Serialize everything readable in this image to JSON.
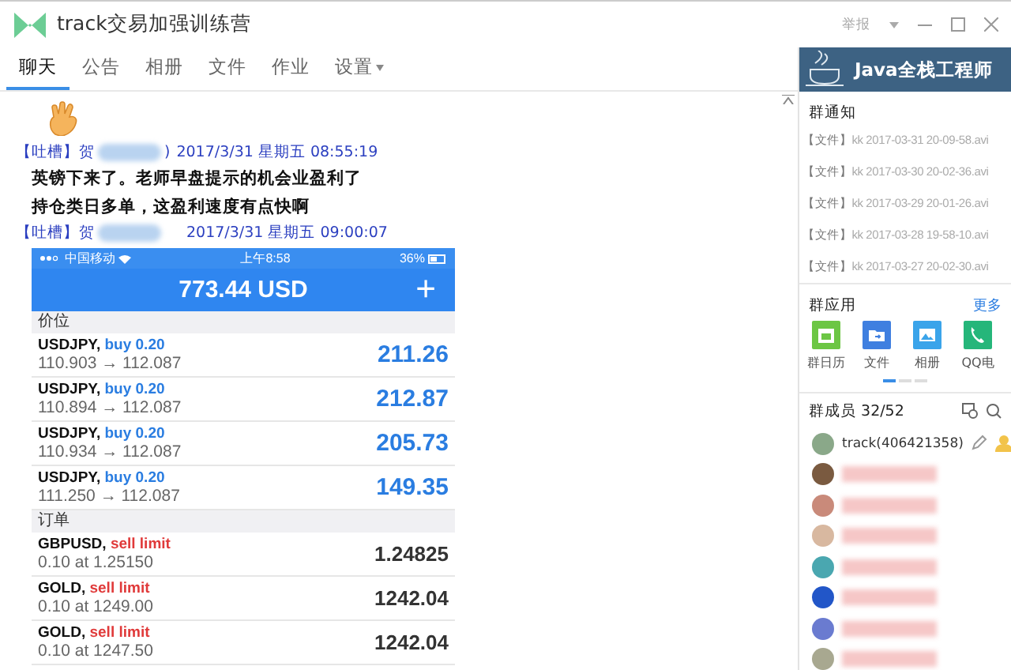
{
  "window": {
    "title": "track交易加强训练营",
    "report": "举报"
  },
  "tabs": [
    {
      "label": "聊天",
      "selected": true,
      "menu": false
    },
    {
      "label": "公告",
      "selected": false,
      "menu": false
    },
    {
      "label": "相册",
      "selected": false,
      "menu": false
    },
    {
      "label": "文件",
      "selected": false,
      "menu": false
    },
    {
      "label": "作业",
      "selected": false,
      "menu": false
    },
    {
      "label": "设置",
      "selected": false,
      "menu": true
    }
  ],
  "chat": {
    "messages": [
      {
        "kind": "emoji"
      },
      {
        "kind": "header",
        "tag": "【吐槽】",
        "sender": "贺",
        "sender_end": ")",
        "time": "2017/3/31 星期五 08:55:19"
      },
      {
        "kind": "text",
        "text": "英镑下来了。老师早盘提示的机会业盈利了"
      },
      {
        "kind": "text",
        "text": "持仓类日多单，这盈利速度有点快啊"
      },
      {
        "kind": "header",
        "tag": "【吐槽】",
        "sender": "贺",
        "time": "2017/3/31 星期五 09:00:07"
      },
      {
        "kind": "screenshot"
      }
    ]
  },
  "phone": {
    "carrier": "中国移动",
    "clock": "上午8:58",
    "battery": "36%",
    "balance": "773.44 USD",
    "add": "+",
    "sections": [
      {
        "title": "价位",
        "rows": [
          {
            "symbol": "USDJPY,",
            "action": "buy 0.20",
            "kind": "buy",
            "detail": "110.903 → 112.087",
            "value": "211.26"
          },
          {
            "symbol": "USDJPY,",
            "action": "buy 0.20",
            "kind": "buy",
            "detail": "110.894 → 112.087",
            "value": "212.87"
          },
          {
            "symbol": "USDJPY,",
            "action": "buy 0.20",
            "kind": "buy",
            "detail": "110.934 → 112.087",
            "value": "205.73"
          },
          {
            "symbol": "USDJPY,",
            "action": "buy 0.20",
            "kind": "buy",
            "detail": "111.250 → 112.087",
            "value": "149.35"
          }
        ]
      },
      {
        "title": "订单",
        "rows": [
          {
            "symbol": "GBPUSD,",
            "action": "sell limit",
            "kind": "sell",
            "detail": "0.10 at 1.25150",
            "value": "1.24825"
          },
          {
            "symbol": "GOLD,",
            "action": "sell limit",
            "kind": "sell",
            "detail": "0.10 at 1249.00",
            "value": "1242.04"
          },
          {
            "symbol": "GOLD,",
            "action": "sell limit",
            "kind": "sell",
            "detail": "0.10 at 1247.50",
            "value": "1242.04"
          }
        ]
      }
    ]
  },
  "side": {
    "banner": "Java全栈工程师",
    "notice_title": "群通知",
    "files": [
      {
        "tag": "【文件】",
        "name": "kk 2017-03-31 20-09-58.avi"
      },
      {
        "tag": "【文件】",
        "name": "kk 2017-03-30 20-02-36.avi"
      },
      {
        "tag": "【文件】",
        "name": "kk 2017-03-29 20-01-26.avi"
      },
      {
        "tag": "【文件】",
        "name": "kk 2017-03-28 19-58-10.avi"
      },
      {
        "tag": "【文件】",
        "name": "kk 2017-03-27 20-02-30.avi"
      }
    ],
    "apps_title": "群应用",
    "more": "更多",
    "apps": [
      {
        "kind": "calendar",
        "label": "群日历"
      },
      {
        "kind": "folder",
        "label": "文件"
      },
      {
        "kind": "photo",
        "label": "相册"
      },
      {
        "kind": "phone",
        "label": "QQ电"
      }
    ],
    "pager": [
      {
        "selected": true
      },
      {
        "selected": false
      },
      {
        "selected": false
      }
    ],
    "members_title": "群成员 32/52",
    "members": [
      {
        "kind": "named",
        "name": "track(406421358)"
      },
      {
        "kind": "blurred"
      },
      {
        "kind": "blurred"
      },
      {
        "kind": "blurred"
      },
      {
        "kind": "blurred"
      },
      {
        "kind": "blurred"
      },
      {
        "kind": "blurred"
      },
      {
        "kind": "blurred"
      }
    ]
  }
}
